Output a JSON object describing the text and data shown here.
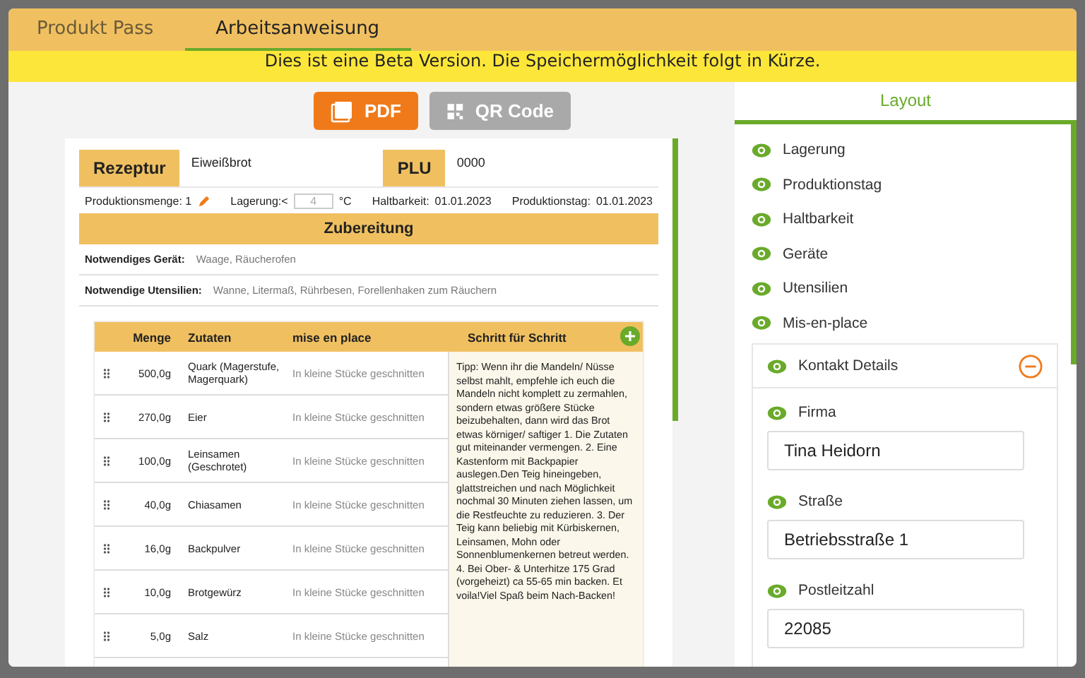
{
  "tabs": [
    {
      "label": "Produkt Pass",
      "selected": false
    },
    {
      "label": "Arbeitsanweisung",
      "selected": true
    }
  ],
  "banner": "Dies ist eine Beta Version. Die Speichermöglichkeit folgt in Kürze.",
  "actions": [
    {
      "label": "PDF",
      "disabled": false
    },
    {
      "label": "QR Code",
      "disabled": true
    }
  ],
  "document": {
    "recipe_label": "Rezeptur",
    "recipe_value": "Eiweißbrot",
    "plu_label": "PLU",
    "plu_value": "0000",
    "quantity": "Produktionsmenge: 1",
    "storage_label": "Lagerung:<",
    "storage_value": "4",
    "storage_unit": "°C",
    "shelf_label": "Haltbarkeit:",
    "shelf_value": "01.01.2023",
    "production_label": "Produktionstag:",
    "production_value": "01.01.2023",
    "section_title": "Zubereitung",
    "requirements": [
      {
        "label": "Notwendiges Gerät:",
        "value": "Waage, Räucherofen"
      },
      {
        "label": "Notwendige Utensilien:",
        "value": "Wanne, Litermaß, Rührbesen, Forellenhaken zum Räuchern"
      }
    ],
    "columns": [
      "Menge",
      "Zutaten",
      "mise en place",
      "Schritt für Schritt"
    ],
    "rows": [
      {
        "amount": "500,0g",
        "ingredient": "Quark (Magerstufe, Magerquark)",
        "prep": "In kleine Stücke geschnitten"
      },
      {
        "amount": "270,0g",
        "ingredient": "Eier",
        "prep": "In kleine Stücke geschnitten"
      },
      {
        "amount": "100,0g",
        "ingredient": "Leinsamen (Geschrotet)",
        "prep": "In kleine Stücke geschnitten"
      },
      {
        "amount": "40,0g",
        "ingredient": "Chiasamen",
        "prep": "In kleine Stücke geschnitten"
      },
      {
        "amount": "16,0g",
        "ingredient": "Backpulver",
        "prep": "In kleine Stücke geschnitten"
      },
      {
        "amount": "10,0g",
        "ingredient": "Brotgewürz",
        "prep": "In kleine Stücke geschnitten"
      },
      {
        "amount": "5,0g",
        "ingredient": "Salz",
        "prep": "In kleine Stücke geschnitten"
      }
    ],
    "steps": "Tipp: Wenn ihr die Mandeln/ Nüsse selbst mahlt, empfehle ich euch die Mandeln nicht komplett zu zermahlen, sondern etwas größere Stücke beizubehalten, dann wird das Brot etwas körniger/ saftiger 1. Die Zutaten gut miteinander vermengen. 2. Eine Kastenform mit Backpapier auslegen.Den Teig hineingeben, glattstreichen und nach Möglichkeit nochmal 30 Minuten ziehen lassen, um die Restfeuchte zu reduzieren. 3. Der Teig kann beliebig mit Kürbiskernen, Leinsamen, Mohn oder Sonnenblumenkernen betreut werden. 4. Bei Ober- & Unterhitze 175 Grad (vorgeheizt) ca 55-65 min backen. Et voila!Viel Spaß beim Nach-Backen!"
  },
  "layout": {
    "title": "Layout",
    "items": [
      {
        "label": "Lagerung",
        "visible": true
      },
      {
        "label": "Produktionstag",
        "visible": true
      },
      {
        "label": "Haltbarkeit",
        "visible": true
      },
      {
        "label": "Geräte",
        "visible": true
      },
      {
        "label": "Utensilien",
        "visible": true
      },
      {
        "label": "Mis-en-place",
        "visible": true
      }
    ],
    "group": {
      "label": "Kontakt Details",
      "visible": true,
      "expanded": true,
      "fields": [
        {
          "label": "Firma",
          "visible": true,
          "value": "Tina Heidorn"
        },
        {
          "label": "Straße",
          "visible": true,
          "value": "Betriebsstraße 1"
        },
        {
          "label": "Postleitzahl",
          "visible": true,
          "value": "22085"
        }
      ]
    }
  }
}
